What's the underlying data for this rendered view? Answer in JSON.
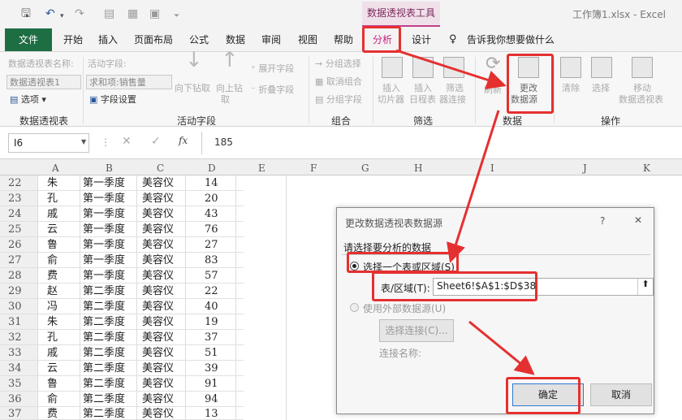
{
  "qat": {
    "context_tab": "数据透视表工具",
    "window_title": "工作簿1.xlsx  -  Excel"
  },
  "tabs": [
    "开始",
    "插入",
    "页面布局",
    "公式",
    "数据",
    "审阅",
    "视图",
    "帮助",
    "分析",
    "设计"
  ],
  "file_tab": "文件",
  "tell_me": "告诉我你想要做什么",
  "ribbon": {
    "pt_name_label": "数据透视表名称:",
    "pt_name_value": "数据透视表1",
    "options_btn": "选项",
    "active_field_label": "活动字段:",
    "active_field_value": "求和项:销售量",
    "field_settings": "字段设置",
    "drill_down": [
      "向下钻取"
    ],
    "drill_up": [
      "向上钻",
      "取"
    ],
    "expand_field": "展开字段",
    "collapse_field": "折叠字段",
    "group_selection": "分组选择",
    "ungroup": "取消组合",
    "group_field": "分组字段",
    "insert_slicer": [
      "插入",
      "切片器"
    ],
    "insert_timeline": [
      "插入",
      "日程表"
    ],
    "filter_connections": [
      "筛选",
      "器连接"
    ],
    "refresh": "刷新",
    "change_source": [
      "更改",
      "数据源"
    ],
    "clear": "清除",
    "select": "选择",
    "move_pt": [
      "移动",
      "数据透视表"
    ],
    "group_labels": {
      "pivot": "数据透视表",
      "active_field": "活动字段",
      "group": "组合",
      "filter": "筛选",
      "data": "数据",
      "actions": "操作"
    }
  },
  "formula_bar": {
    "cell": "I6",
    "value": "185",
    "fx": "fx"
  },
  "columns": [
    "A",
    "B",
    "C",
    "D",
    "E",
    "F",
    "G",
    "H",
    "I",
    "J",
    "K"
  ],
  "rows": [
    {
      "n": "22",
      "a": "朱",
      "b": "第一季度",
      "c": "美容仪",
      "d": "14"
    },
    {
      "n": "23",
      "a": "孔",
      "b": "第一季度",
      "c": "美容仪",
      "d": "20"
    },
    {
      "n": "24",
      "a": "戚",
      "b": "第一季度",
      "c": "美容仪",
      "d": "43"
    },
    {
      "n": "25",
      "a": "云",
      "b": "第一季度",
      "c": "美容仪",
      "d": "76"
    },
    {
      "n": "26",
      "a": "鲁",
      "b": "第一季度",
      "c": "美容仪",
      "d": "27"
    },
    {
      "n": "27",
      "a": "俞",
      "b": "第一季度",
      "c": "美容仪",
      "d": "83"
    },
    {
      "n": "28",
      "a": "费",
      "b": "第一季度",
      "c": "美容仪",
      "d": "57"
    },
    {
      "n": "29",
      "a": "赵",
      "b": "第二季度",
      "c": "美容仪",
      "d": "22"
    },
    {
      "n": "30",
      "a": "冯",
      "b": "第二季度",
      "c": "美容仪",
      "d": "40"
    },
    {
      "n": "31",
      "a": "朱",
      "b": "第二季度",
      "c": "美容仪",
      "d": "19"
    },
    {
      "n": "32",
      "a": "孔",
      "b": "第二季度",
      "c": "美容仪",
      "d": "37"
    },
    {
      "n": "33",
      "a": "戚",
      "b": "第二季度",
      "c": "美容仪",
      "d": "51"
    },
    {
      "n": "34",
      "a": "云",
      "b": "第二季度",
      "c": "美容仪",
      "d": "39"
    },
    {
      "n": "35",
      "a": "鲁",
      "b": "第二季度",
      "c": "美容仪",
      "d": "91"
    },
    {
      "n": "36",
      "a": "俞",
      "b": "第二季度",
      "c": "美容仪",
      "d": "94"
    },
    {
      "n": "37",
      "a": "费",
      "b": "第二季度",
      "c": "美容仪",
      "d": "13"
    }
  ],
  "dialog": {
    "title": "更改数据透视表数据源",
    "help": "?",
    "close": "✕",
    "section": "请选择要分析的数据",
    "opt1": "选择一个表或区域(S)",
    "range_label": "表/区域(T):",
    "range_value": "Sheet6!$A$1:$D$38",
    "opt2": "使用外部数据源(U)",
    "choose_conn": "选择连接(C)...",
    "conn_name": "连接名称:",
    "ok": "确定",
    "cancel": "取消"
  },
  "colors": {
    "excel_green": "#1e6e43",
    "highlight_red": "#e53030",
    "context_pink": "#c3247d"
  }
}
